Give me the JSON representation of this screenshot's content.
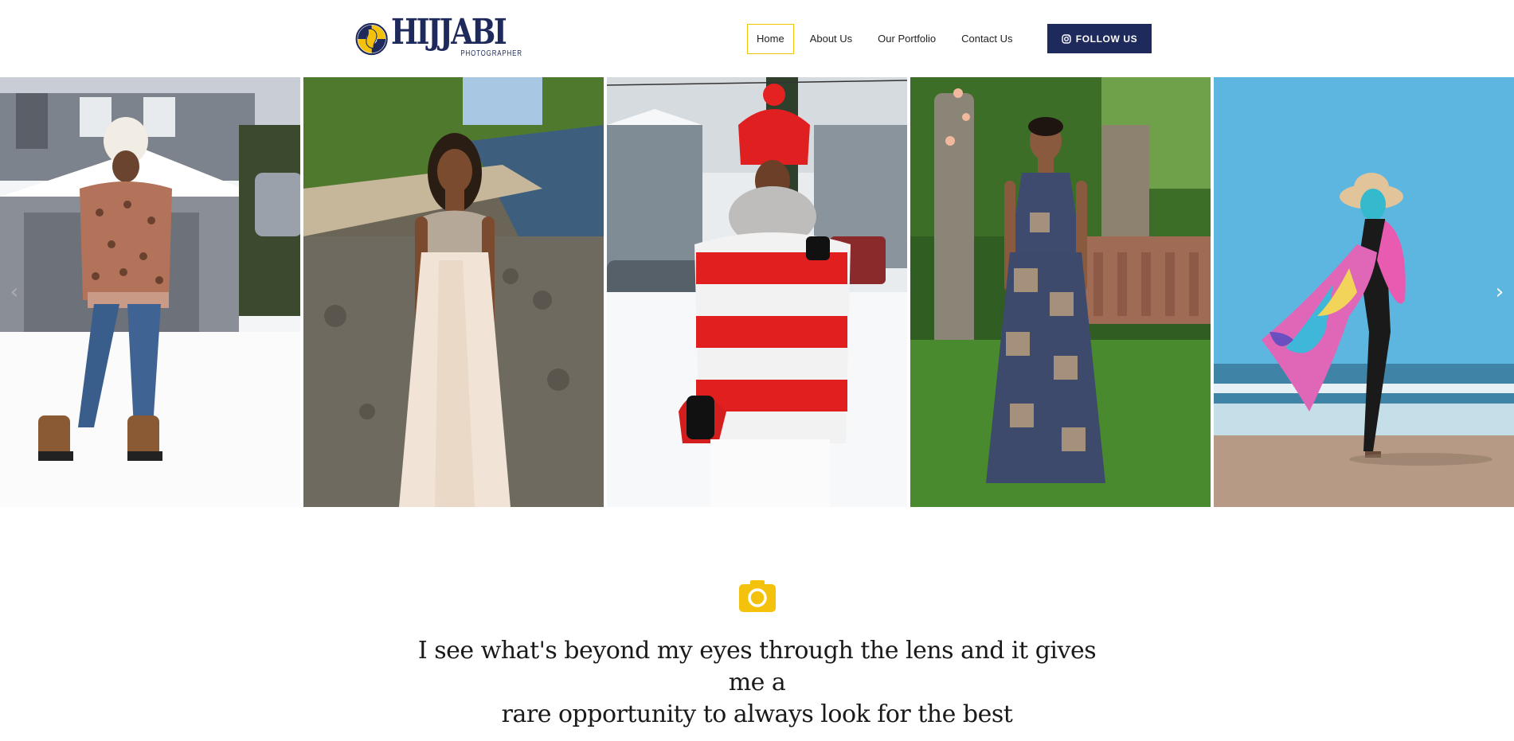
{
  "header": {
    "logo": {
      "main_text": "HIJJABI",
      "sub_text": "PHOTOGRAPHER",
      "icon": "photographer-logo-icon"
    },
    "nav": [
      {
        "label": "Home",
        "active": true
      },
      {
        "label": "About Us",
        "active": false
      },
      {
        "label": "Our Portfolio",
        "active": false
      },
      {
        "label": "Contact Us",
        "active": false
      }
    ],
    "follow_button": {
      "label": "FOLLOW US",
      "icon": "instagram-icon"
    }
  },
  "carousel": {
    "slides": [
      {
        "name": "slide-snow-leopard-sweater"
      },
      {
        "name": "slide-lakeside-gown"
      },
      {
        "name": "slide-red-striped-sweater"
      },
      {
        "name": "slide-garden-print-dress"
      },
      {
        "name": "slide-beach-scarf"
      }
    ],
    "prev_icon": "chevron-left-icon",
    "next_icon": "chevron-right-icon",
    "prev_glyph": "‹",
    "next_glyph": "›"
  },
  "intro": {
    "icon": "camera-icon",
    "quote_line1": "I see what's beyond my eyes through the lens and it gives me a",
    "quote_line2": "rare opportunity to always look for the best"
  },
  "colors": {
    "brand_navy": "#1f2a5c",
    "accent_yellow": "#f4c20d"
  }
}
